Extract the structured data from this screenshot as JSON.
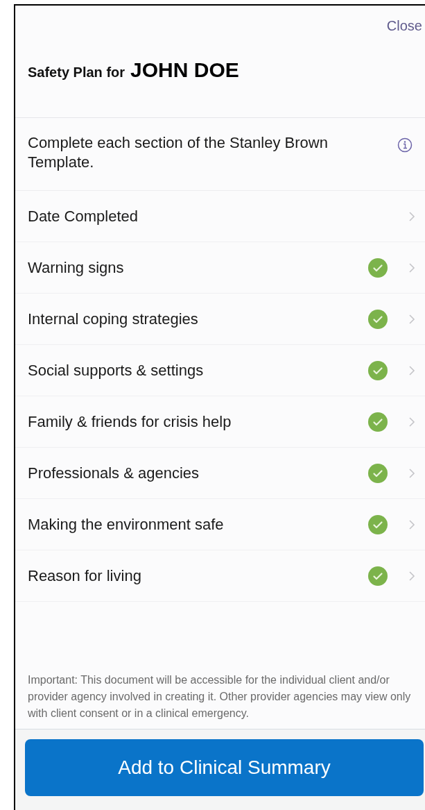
{
  "header": {
    "close": "Close",
    "title": "Safety Plan for",
    "name": "JOHN DOE"
  },
  "intro": "Complete each section of the Stanley Brown Template.",
  "sections": [
    {
      "label": "Date Completed",
      "completed": false
    },
    {
      "label": "Warning signs",
      "completed": true
    },
    {
      "label": "Internal coping strategies",
      "completed": true
    },
    {
      "label": "Social supports & settings",
      "completed": true
    },
    {
      "label": "Family & friends for crisis help",
      "completed": true
    },
    {
      "label": "Professionals & agencies",
      "completed": true
    },
    {
      "label": "Making the environment safe",
      "completed": true
    },
    {
      "label": "Reason for living",
      "completed": true
    }
  ],
  "notice": "Important: This document will be accessible for the individual client and/or provider agency involved in creating it. Other provider agencies may view only with client consent or in a clinical emergency.",
  "action_button": "Add to Clinical Summary"
}
